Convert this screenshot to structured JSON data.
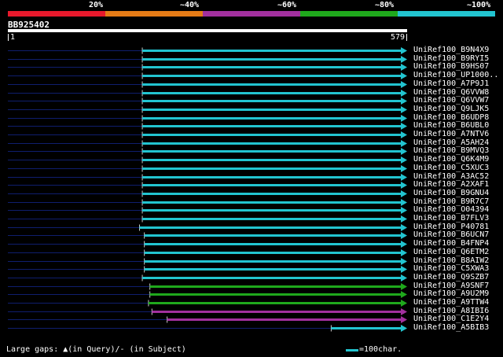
{
  "legend": {
    "labels": [
      "20%",
      "~40%",
      "~60%",
      "~80%",
      "~100%"
    ],
    "colors": [
      "#e8192c",
      "#e57b16",
      "#a2309e",
      "#1fa81c",
      "#22c4d0"
    ]
  },
  "query": {
    "id": "BB925402",
    "start": "1",
    "end": "579",
    "bar_color": "#ffffff"
  },
  "colors": {
    "background": "#000000",
    "unaligned_line": "#0f1e6e",
    "gap_marker": "#000000"
  },
  "scale": {
    "query_length": 579
  },
  "hits": [
    {
      "label": "UniRef100_B9N4X9",
      "color": "#22c4d0",
      "start": 196,
      "end": 579
    },
    {
      "label": "UniRef100_B9RYI5",
      "color": "#22c4d0",
      "start": 196,
      "end": 579
    },
    {
      "label": "UniRef100_B9HS07",
      "color": "#22c4d0",
      "start": 196,
      "end": 579
    },
    {
      "label": "UniRef100_UP1000..",
      "color": "#22c4d0",
      "start": 196,
      "end": 579
    },
    {
      "label": "UniRef100_A7P9J1",
      "color": "#22c4d0",
      "start": 196,
      "end": 579
    },
    {
      "label": "UniRef100_Q6VVW8",
      "color": "#22c4d0",
      "start": 196,
      "end": 579
    },
    {
      "label": "UniRef100_Q6VVW7",
      "color": "#22c4d0",
      "start": 196,
      "end": 579
    },
    {
      "label": "UniRef100_Q9LJK5",
      "color": "#22c4d0",
      "start": 196,
      "end": 579
    },
    {
      "label": "UniRef100_B6UDP8",
      "color": "#22c4d0",
      "start": 196,
      "end": 579
    },
    {
      "label": "UniRef100_B6UBL0",
      "color": "#22c4d0",
      "start": 196,
      "end": 579
    },
    {
      "label": "UniRef100_A7NTV6",
      "color": "#22c4d0",
      "start": 196,
      "end": 579
    },
    {
      "label": "UniRef100_A5AH24",
      "color": "#22c4d0",
      "start": 196,
      "end": 579
    },
    {
      "label": "UniRef100_B9MVQ3",
      "color": "#22c4d0",
      "start": 196,
      "end": 579
    },
    {
      "label": "UniRef100_Q6K4M9",
      "color": "#22c4d0",
      "start": 196,
      "end": 579
    },
    {
      "label": "UniRef100_C5XUC3",
      "color": "#22c4d0",
      "start": 196,
      "end": 579
    },
    {
      "label": "UniRef100_A3AC52",
      "color": "#22c4d0",
      "start": 196,
      "end": 579
    },
    {
      "label": "UniRef100_A2XAF1",
      "color": "#22c4d0",
      "start": 196,
      "end": 579
    },
    {
      "label": "UniRef100_B9GNU4",
      "color": "#22c4d0",
      "start": 196,
      "end": 579
    },
    {
      "label": "UniRef100_B9R7C7",
      "color": "#22c4d0",
      "start": 196,
      "end": 579
    },
    {
      "label": "UniRef100_O04394",
      "color": "#22c4d0",
      "start": 196,
      "end": 579
    },
    {
      "label": "UniRef100_B7FLV3",
      "color": "#22c4d0",
      "start": 196,
      "end": 579
    },
    {
      "label": "UniRef100_P40781",
      "color": "#22c4d0",
      "start": 192,
      "end": 579
    },
    {
      "label": "UniRef100_B6UCN7",
      "color": "#22c4d0",
      "start": 199,
      "end": 579
    },
    {
      "label": "UniRef100_B4FNP4",
      "color": "#22c4d0",
      "start": 199,
      "end": 579
    },
    {
      "label": "UniRef100_Q6ETM2",
      "color": "#22c4d0",
      "start": 199,
      "end": 579
    },
    {
      "label": "UniRef100_B8AIW2",
      "color": "#22c4d0",
      "start": 199,
      "end": 579
    },
    {
      "label": "UniRef100_C5XWA3",
      "color": "#22c4d0",
      "start": 199,
      "end": 579
    },
    {
      "label": "UniRef100_Q9SZB7",
      "color": "#22c4d0",
      "start": 196,
      "end": 579
    },
    {
      "label": "UniRef100_A9SNF7",
      "color": "#1fa81c",
      "start": 207,
      "end": 579
    },
    {
      "label": "UniRef100_A9U2M9",
      "color": "#1fa81c",
      "start": 207,
      "end": 579
    },
    {
      "label": "UniRef100_A9TTW4",
      "color": "#1fa81c",
      "start": 205,
      "end": 579
    },
    {
      "label": "UniRef100_A8IBI6",
      "color": "#a2309e",
      "start": 210,
      "end": 579
    },
    {
      "label": "UniRef100_C1E2Y4",
      "color": "#a2309e",
      "start": 232,
      "end": 579
    },
    {
      "label": "UniRef100_A5BIB3",
      "color": "#22c4d0",
      "start": 470,
      "end": 579
    }
  ],
  "footer": {
    "gaps_text": "Large gaps: ▲(in Query)/‐ (in Subject)",
    "scale_text": "=100char."
  }
}
